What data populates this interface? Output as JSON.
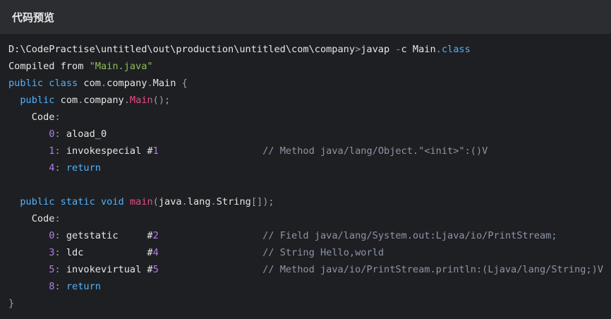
{
  "header": {
    "title": "代码预览"
  },
  "colors": {
    "default": "#e6e6e6",
    "keyword": "#4fb2ff",
    "string": "#8fbf59",
    "func": "#e24d87",
    "number": "#b47cf0",
    "comment": "#8c95a6",
    "punct": "#9aa0a8"
  },
  "code_lines": [
    [
      [
        "D:\\CodePractise\\untitled\\out\\production\\untitled\\com\\company",
        "default"
      ],
      [
        ">",
        "punct"
      ],
      [
        "javap ",
        "default"
      ],
      [
        "-",
        "punct"
      ],
      [
        "c Main",
        "default"
      ],
      [
        ".",
        "punct"
      ],
      [
        "class",
        "keyword"
      ]
    ],
    [
      [
        "Compiled from ",
        "default"
      ],
      [
        "\"Main.java\"",
        "string"
      ]
    ],
    [
      [
        "public",
        "keyword"
      ],
      [
        " ",
        "default"
      ],
      [
        "class",
        "keyword"
      ],
      [
        " com",
        "default"
      ],
      [
        ".",
        "punct"
      ],
      [
        "company",
        "default"
      ],
      [
        ".",
        "punct"
      ],
      [
        "Main ",
        "default"
      ],
      [
        "{",
        "punct"
      ]
    ],
    [
      [
        "  ",
        "default"
      ],
      [
        "public",
        "keyword"
      ],
      [
        " com",
        "default"
      ],
      [
        ".",
        "punct"
      ],
      [
        "company",
        "default"
      ],
      [
        ".",
        "punct"
      ],
      [
        "Main",
        "func"
      ],
      [
        "();",
        "punct"
      ]
    ],
    [
      [
        "    Code",
        "default"
      ],
      [
        ":",
        "punct"
      ]
    ],
    [
      [
        "       ",
        "default"
      ],
      [
        "0",
        "number"
      ],
      [
        ": ",
        "punct"
      ],
      [
        "aload_0",
        "default"
      ]
    ],
    [
      [
        "       ",
        "default"
      ],
      [
        "1",
        "number"
      ],
      [
        ": ",
        "punct"
      ],
      [
        "invokespecial #",
        "default"
      ],
      [
        "1",
        "number"
      ],
      [
        "                  ",
        "default"
      ],
      [
        "// Method java/lang/Object.\"<init>\":()V",
        "comment"
      ]
    ],
    [
      [
        "       ",
        "default"
      ],
      [
        "4",
        "number"
      ],
      [
        ": ",
        "punct"
      ],
      [
        "return",
        "keyword"
      ]
    ],
    [
      [
        "",
        "default"
      ]
    ],
    [
      [
        "  ",
        "default"
      ],
      [
        "public",
        "keyword"
      ],
      [
        " ",
        "default"
      ],
      [
        "static",
        "keyword"
      ],
      [
        " ",
        "default"
      ],
      [
        "void",
        "keyword"
      ],
      [
        " ",
        "default"
      ],
      [
        "main",
        "func"
      ],
      [
        "(",
        "punct"
      ],
      [
        "java",
        "default"
      ],
      [
        ".",
        "punct"
      ],
      [
        "lang",
        "default"
      ],
      [
        ".",
        "punct"
      ],
      [
        "String",
        "default"
      ],
      [
        "[]);",
        "punct"
      ]
    ],
    [
      [
        "    Code",
        "default"
      ],
      [
        ":",
        "punct"
      ]
    ],
    [
      [
        "       ",
        "default"
      ],
      [
        "0",
        "number"
      ],
      [
        ": ",
        "punct"
      ],
      [
        "getstatic     #",
        "default"
      ],
      [
        "2",
        "number"
      ],
      [
        "                  ",
        "default"
      ],
      [
        "// Field java/lang/System.out:Ljava/io/PrintStream;",
        "comment"
      ]
    ],
    [
      [
        "       ",
        "default"
      ],
      [
        "3",
        "number"
      ],
      [
        ": ",
        "punct"
      ],
      [
        "ldc           #",
        "default"
      ],
      [
        "4",
        "number"
      ],
      [
        "                  ",
        "default"
      ],
      [
        "// String Hello,world",
        "comment"
      ]
    ],
    [
      [
        "       ",
        "default"
      ],
      [
        "5",
        "number"
      ],
      [
        ": ",
        "punct"
      ],
      [
        "invokevirtual #",
        "default"
      ],
      [
        "5",
        "number"
      ],
      [
        "                  ",
        "default"
      ],
      [
        "// Method java/io/PrintStream.println:(Ljava/lang/String;)V",
        "comment"
      ]
    ],
    [
      [
        "       ",
        "default"
      ],
      [
        "8",
        "number"
      ],
      [
        ": ",
        "punct"
      ],
      [
        "return",
        "keyword"
      ]
    ],
    [
      [
        "}",
        "punct"
      ]
    ]
  ]
}
